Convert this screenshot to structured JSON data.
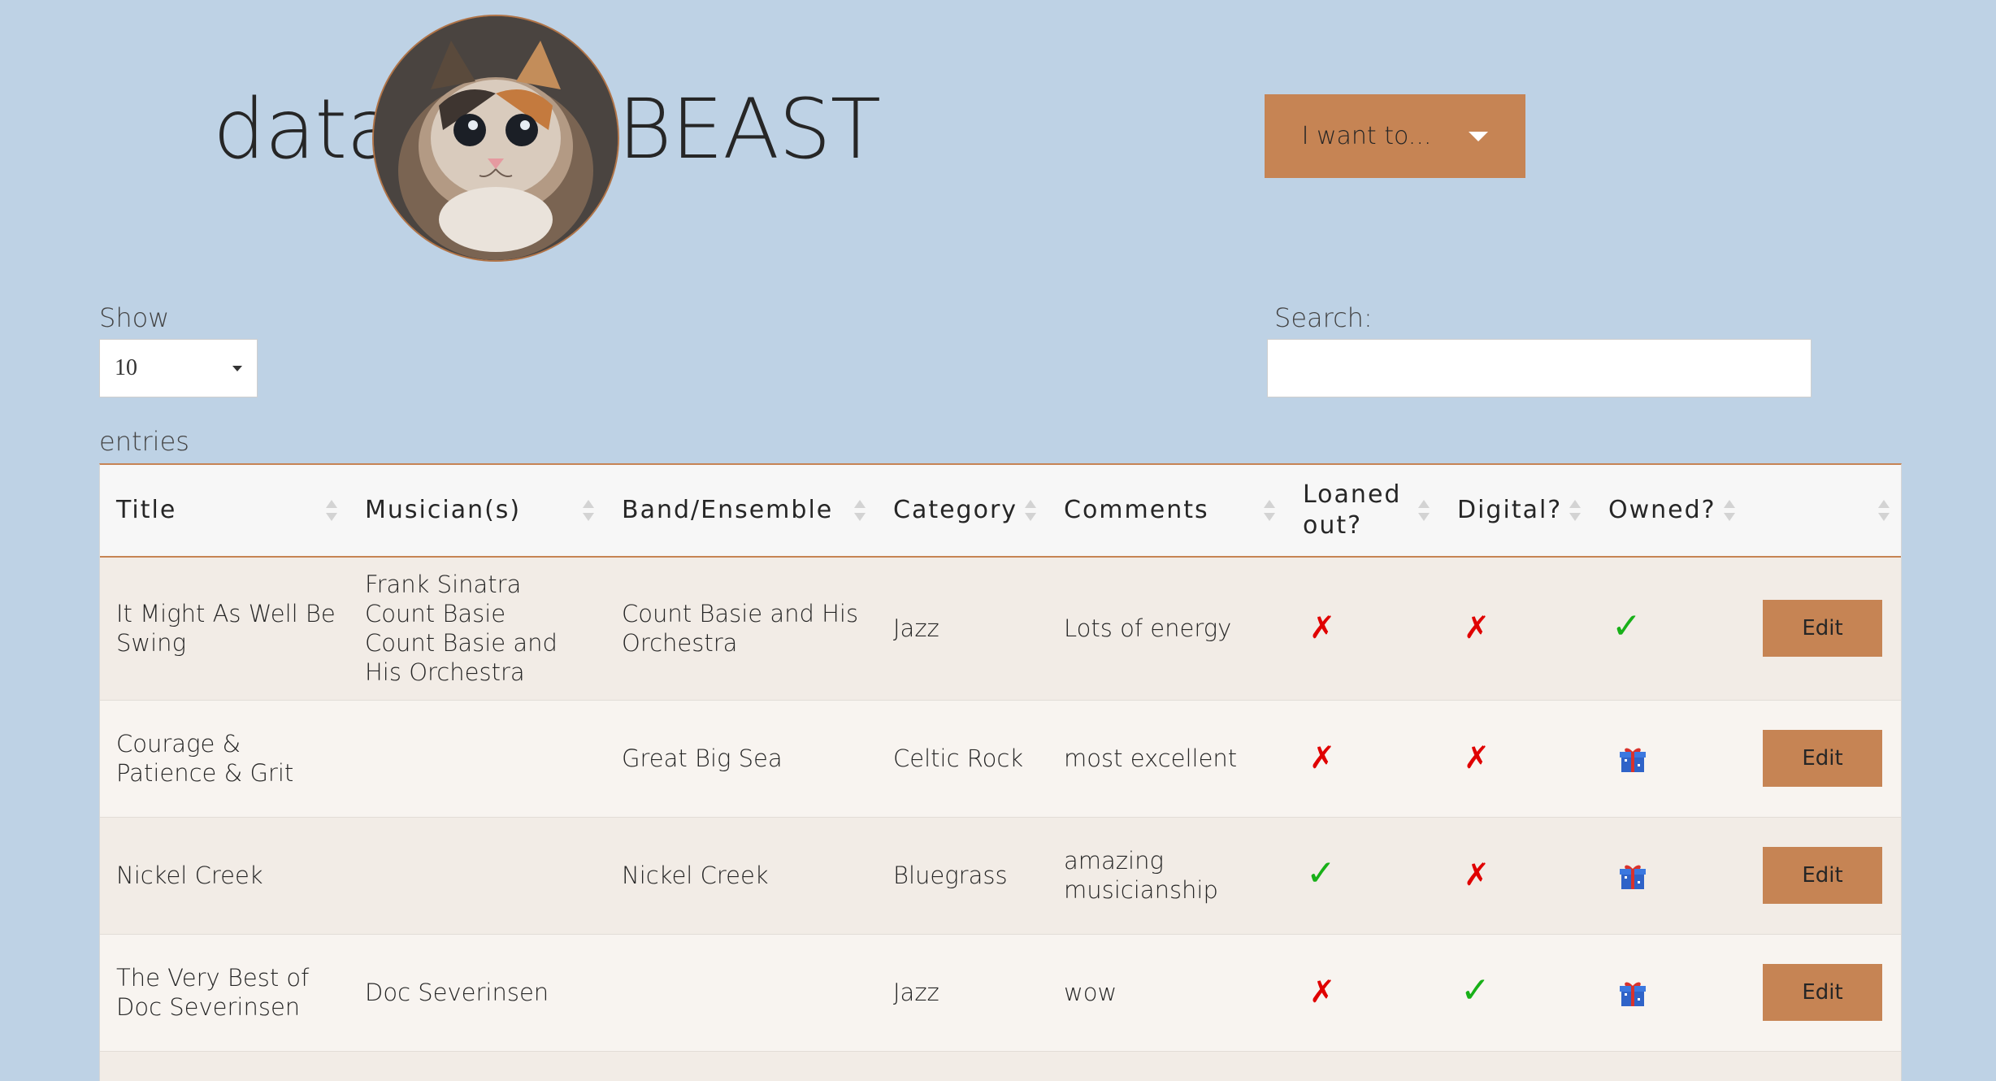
{
  "header": {
    "logo_left": "data",
    "logo_right": "BEAST",
    "menu_button_label": "I want to..."
  },
  "controls": {
    "show_label": "Show",
    "show_value": "10",
    "entries_label": "entries",
    "search_label": "Search:",
    "search_value": ""
  },
  "table": {
    "columns": [
      "Title",
      "Musician(s)",
      "Band/Ensemble",
      "Category",
      "Comments",
      "Loaned out?",
      "Digital?",
      "Owned?",
      ""
    ],
    "rows": [
      {
        "title": "It Might As Well Be Swing",
        "musicians": [
          "Frank Sinatra",
          "Count Basie",
          "Count Basie and His Orchestra"
        ],
        "band": "Count Basie and His Orchestra",
        "category": "Jazz",
        "comments": "Lots of energy",
        "loaned": "✗",
        "digital": "✗",
        "owned": "✓",
        "owned_icon": "check-icon",
        "action": "Edit"
      },
      {
        "title": "Courage & Patience & Grit",
        "musicians": [],
        "band": "Great Big Sea",
        "category": "Celtic Rock",
        "comments": "most excellent",
        "loaned": "✗",
        "digital": "✗",
        "owned": "",
        "owned_icon": "gift-icon",
        "action": "Edit"
      },
      {
        "title": "Nickel Creek",
        "musicians": [],
        "band": "Nickel Creek",
        "category": "Bluegrass",
        "comments": "amazing musicianship",
        "loaned": "✓",
        "digital": "✗",
        "owned": "",
        "owned_icon": "gift-icon",
        "action": "Edit"
      },
      {
        "title": "The Very Best of Doc Severinsen",
        "musicians": [
          "Doc Severinsen"
        ],
        "band": "",
        "category": "Jazz",
        "comments": "wow",
        "loaned": "✗",
        "digital": "✓",
        "owned": "",
        "owned_icon": "gift-icon",
        "action": "Edit"
      }
    ]
  },
  "colors": {
    "background": "#bed2e5",
    "accent": "#c68454",
    "cross": "#e00000",
    "check": "#18b018"
  }
}
